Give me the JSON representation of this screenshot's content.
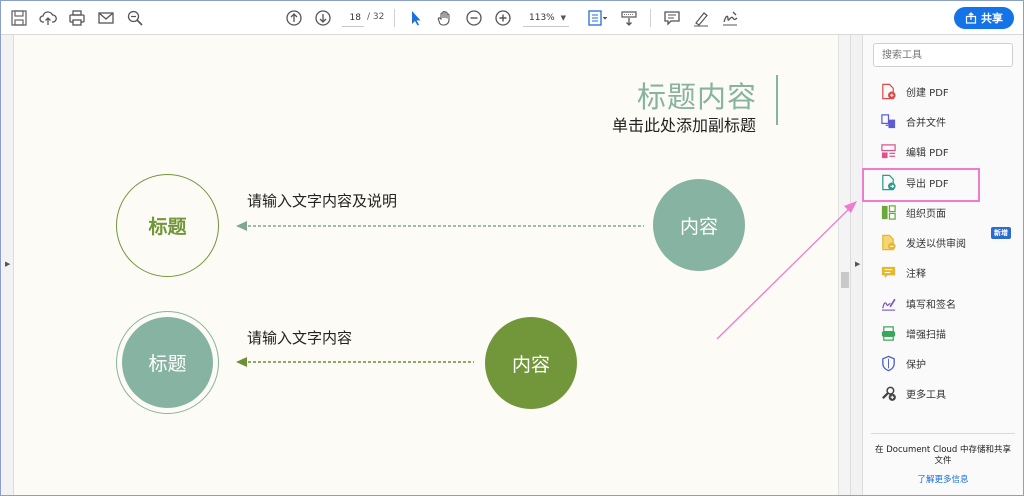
{
  "toolbar": {
    "page_current": "18",
    "page_total": "/ 32",
    "zoom": "113%",
    "share_label": "共享",
    "icons": [
      "save-icon",
      "upload-cloud-icon",
      "print-icon",
      "email-icon",
      "search-zoom-icon",
      "page-up-icon",
      "page-down-icon",
      "select-cursor-icon",
      "hand-icon",
      "zoom-out-icon",
      "zoom-in-icon",
      "fit-page-icon",
      "scroll-mode-icon",
      "comment-icon",
      "highlight-pen-icon",
      "sign-icon"
    ]
  },
  "slide": {
    "title": "标题内容",
    "subtitle": "单击此处添加副标题",
    "row1": {
      "text": "请输入文字内容及说明",
      "left_circle": "标题",
      "right_circle": "内容"
    },
    "row2": {
      "text": "请输入文字内容",
      "left_circle": "标题",
      "right_circle": "内容"
    },
    "colors": {
      "teal": "#87b3a2",
      "olive": "#72963a",
      "dashed_teal": "#7fa893",
      "dashed_olive": "#6d8f36"
    }
  },
  "panel": {
    "search_placeholder": "搜索工具",
    "tools": [
      {
        "label": "创建 PDF",
        "icon": "create-pdf-icon",
        "color": "#e04848"
      },
      {
        "label": "合并文件",
        "icon": "combine-files-icon",
        "color": "#5b5bd6"
      },
      {
        "label": "编辑 PDF",
        "icon": "edit-pdf-icon",
        "color": "#e0508c"
      },
      {
        "label": "导出 PDF",
        "icon": "export-pdf-icon",
        "color": "#2a9a8c"
      },
      {
        "label": "组织页面",
        "icon": "organize-pages-icon",
        "color": "#6aa83a"
      },
      {
        "label": "发送以供审阅",
        "icon": "send-review-icon",
        "color": "#e6b82e"
      },
      {
        "label": "注释",
        "icon": "comment-tool-icon",
        "color": "#e6b82e"
      },
      {
        "label": "填写和签名",
        "icon": "fill-sign-icon",
        "color": "#7b54c9"
      },
      {
        "label": "增强扫描",
        "icon": "enhance-scan-icon",
        "color": "#3aa65a"
      },
      {
        "label": "保护",
        "icon": "protect-icon",
        "color": "#4a5fc7"
      },
      {
        "label": "更多工具",
        "icon": "more-tools-icon",
        "color": "#444444"
      }
    ],
    "new_badge": "新增",
    "cloud_text": "在 Document Cloud 中存储和共享文件",
    "learn_more": "了解更多信息"
  },
  "annotation": {
    "highlight_color": "#ef7bd0"
  }
}
